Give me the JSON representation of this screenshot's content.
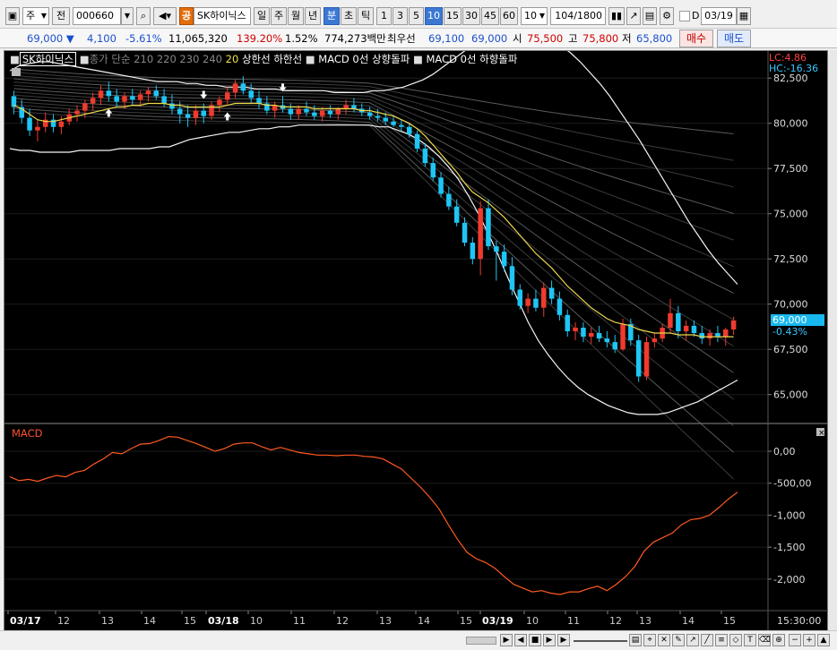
{
  "toolbar": {
    "market": "주",
    "prev": "전",
    "code": "000660",
    "logo": "공",
    "name": "SK하이닉스",
    "periods": [
      "일",
      "주",
      "월",
      "년"
    ],
    "intraday": [
      "분",
      "초",
      "틱"
    ],
    "minutes": [
      "1",
      "3",
      "5",
      "10",
      "15",
      "30",
      "45",
      "60"
    ],
    "active_minute": "10",
    "count": "10",
    "range": "104/1800",
    "d_label": "D",
    "date": "03/19"
  },
  "quote": {
    "price": "69,000",
    "arrow": "▼",
    "change": "4,100",
    "change_pct": "-5.61%",
    "volume": "11,065,320",
    "vol_ratio": "139.20%",
    "turnover": "1.52%",
    "amount": "774,273백만",
    "bid_label": "최우선",
    "bid": "69,100",
    "ask": "69,000",
    "open_label": "시",
    "open": "75,500",
    "high_label": "고",
    "high": "75,800",
    "low_label": "저",
    "low": "65,800",
    "buy": "매수",
    "sell": "매도"
  },
  "legend": {
    "name": "SK하이닉스",
    "ma": "종가 단순",
    "ma_periods": "210 220 230 240",
    "ma20": "20",
    "bands": "상한선  하한선",
    "macd_up": "MACD 0선 상향돌파",
    "macd_down": "MACD 0선 하향돌파",
    "lc": "LC:4.86",
    "hc": "HC:-16.36",
    "price_tag": "69,000",
    "pct_tag": "-0.43%"
  },
  "macd_label": "MACD",
  "chart_data": [
    {
      "type": "candlestick",
      "title": "SK하이닉스",
      "x": [
        "03/17",
        "12",
        "13",
        "14",
        "15",
        "03/18",
        "10",
        "11",
        "12",
        "13",
        "14",
        "15",
        "03/19",
        "10",
        "11",
        "12",
        "13",
        "14",
        "15"
      ],
      "ylim": [
        63500,
        83500
      ],
      "yticks": [
        65000,
        67500,
        70000,
        72500,
        75000,
        77500,
        80000,
        82500
      ],
      "ytick_labels": [
        "65,000",
        "67,500",
        "70,000",
        "72,500",
        "75,000",
        "77,500",
        "80,000",
        "82,500"
      ],
      "candles": [
        [
          81500,
          81800,
          80500,
          80900
        ],
        [
          80900,
          81300,
          80000,
          80300
        ],
        [
          80300,
          80800,
          79300,
          79600
        ],
        [
          79600,
          80200,
          79000,
          79800
        ],
        [
          79800,
          80600,
          79500,
          80200
        ],
        [
          80200,
          80500,
          79500,
          79800
        ],
        [
          79800,
          80400,
          79400,
          80100
        ],
        [
          80100,
          80800,
          79900,
          80500
        ],
        [
          80500,
          81000,
          80100,
          80700
        ],
        [
          80700,
          81300,
          80300,
          81100
        ],
        [
          81100,
          81700,
          80700,
          81400
        ],
        [
          81400,
          82100,
          81000,
          81800
        ],
        [
          81800,
          82300,
          81200,
          81500
        ],
        [
          81500,
          81900,
          80900,
          81200
        ],
        [
          81200,
          81700,
          80800,
          81500
        ],
        [
          81500,
          81900,
          81000,
          81300
        ],
        [
          81300,
          81800,
          80900,
          81600
        ],
        [
          81600,
          82000,
          81200,
          81800
        ],
        [
          81800,
          82100,
          81300,
          81500
        ],
        [
          81500,
          81900,
          80900,
          81100
        ],
        [
          81100,
          81600,
          80500,
          80800
        ],
        [
          80800,
          81200,
          80000,
          80500
        ],
        [
          80500,
          81000,
          79800,
          80300
        ],
        [
          80300,
          81000,
          79900,
          80700
        ],
        [
          80700,
          81100,
          80000,
          80400
        ],
        [
          80400,
          81200,
          80200,
          81000
        ],
        [
          81000,
          81500,
          80600,
          81300
        ],
        [
          81300,
          82000,
          81000,
          81700
        ],
        [
          81700,
          82400,
          81400,
          82200
        ],
        [
          82200,
          82600,
          81600,
          81800
        ],
        [
          81800,
          82200,
          81100,
          81400
        ],
        [
          81400,
          81800,
          80800,
          81100
        ],
        [
          81100,
          81500,
          80500,
          80700
        ],
        [
          80700,
          81200,
          80300,
          81000
        ],
        [
          81000,
          81500,
          80600,
          80800
        ],
        [
          80800,
          81100,
          80200,
          80500
        ],
        [
          80500,
          81000,
          80200,
          80800
        ],
        [
          80800,
          81200,
          80400,
          80600
        ],
        [
          80600,
          81000,
          80200,
          80400
        ],
        [
          80400,
          80900,
          80100,
          80700
        ],
        [
          80700,
          81000,
          80300,
          80500
        ],
        [
          80500,
          80900,
          80200,
          80800
        ],
        [
          80800,
          81300,
          80500,
          81000
        ],
        [
          81000,
          81400,
          80600,
          80800
        ],
        [
          80800,
          81100,
          80400,
          80600
        ],
        [
          80600,
          80900,
          80200,
          80400
        ],
        [
          80400,
          80800,
          80100,
          80300
        ],
        [
          80300,
          80600,
          79900,
          80100
        ],
        [
          80100,
          80400,
          79800,
          79900
        ],
        [
          79900,
          80200,
          79600,
          79800
        ],
        [
          79800,
          80000,
          79200,
          79400
        ],
        [
          79400,
          79600,
          78400,
          78600
        ],
        [
          78600,
          78900,
          77600,
          77800
        ],
        [
          77800,
          78100,
          76800,
          77000
        ],
        [
          77000,
          77300,
          75900,
          76100
        ],
        [
          76100,
          76500,
          75200,
          75400
        ],
        [
          75400,
          75800,
          74300,
          74500
        ],
        [
          74500,
          74800,
          73200,
          73400
        ],
        [
          73400,
          73700,
          72200,
          72500
        ],
        [
          72500,
          75700,
          71600,
          75300
        ],
        [
          75300,
          75800,
          73000,
          73200
        ],
        [
          73200,
          73500,
          71300,
          72900
        ],
        [
          72900,
          73300,
          71800,
          72100
        ],
        [
          72100,
          72600,
          70500,
          70800
        ],
        [
          70800,
          71100,
          69700,
          69900
        ],
        [
          69900,
          70600,
          69500,
          70300
        ],
        [
          70300,
          70800,
          69600,
          69800
        ],
        [
          69800,
          71200,
          69300,
          70900
        ],
        [
          70900,
          71300,
          70000,
          70300
        ],
        [
          70300,
          70700,
          69100,
          69400
        ],
        [
          69400,
          69700,
          68200,
          68500
        ],
        [
          68500,
          69000,
          68000,
          68700
        ],
        [
          68700,
          69000,
          67900,
          68200
        ],
        [
          68200,
          68700,
          67800,
          68400
        ],
        [
          68400,
          68800,
          67900,
          68100
        ],
        [
          68100,
          68500,
          67600,
          67900
        ],
        [
          67900,
          68300,
          67300,
          67500
        ],
        [
          67500,
          69200,
          67400,
          68900
        ],
        [
          68900,
          69200,
          67700,
          68000
        ],
        [
          68000,
          68300,
          65700,
          66000
        ],
        [
          66000,
          68200,
          65800,
          67900
        ],
        [
          67900,
          68400,
          67600,
          68100
        ],
        [
          68100,
          68900,
          67900,
          68700
        ],
        [
          68700,
          70300,
          68400,
          69500
        ],
        [
          69500,
          69900,
          68100,
          68500
        ],
        [
          68500,
          69100,
          68000,
          68800
        ],
        [
          68800,
          69100,
          68200,
          68400
        ],
        [
          68400,
          68800,
          67800,
          68100
        ],
        [
          68100,
          68600,
          67700,
          68400
        ],
        [
          68400,
          68800,
          67900,
          68200
        ],
        [
          68200,
          68700,
          67700,
          68600
        ],
        [
          68600,
          69300,
          68300,
          69100
        ]
      ],
      "series": [
        {
          "name": "20",
          "values": [
            81000,
            80800,
            80500,
            80200,
            80100,
            80100,
            80200,
            80300,
            80400,
            80500,
            80600,
            80700,
            80800,
            80900,
            80900,
            81000,
            81000,
            81100,
            81100,
            81100,
            81000,
            81000,
            80900,
            80900,
            80900,
            80900,
            80900,
            81000,
            81100,
            81100,
            81100,
            81100,
            81000,
            81000,
            80900,
            80900,
            80900,
            80900,
            80800,
            80800,
            80800,
            80800,
            80800,
            80800,
            80700,
            80700,
            80600,
            80500,
            80400,
            80200,
            80000,
            79700,
            79300,
            78800,
            78300,
            77800,
            77300,
            76700,
            76200,
            75900,
            75600,
            75200,
            74800,
            74300,
            73800,
            73300,
            72800,
            72400,
            72000,
            71500,
            71000,
            70600,
            70200,
            69800,
            69500,
            69200,
            69000,
            68900,
            68800,
            68600,
            68500,
            68400,
            68400,
            68400,
            68300,
            68300,
            68300,
            68200,
            68200,
            68200,
            68200,
            68200
          ]
        },
        {
          "name": "상한선",
          "values": [
            82900,
            83200,
            83300,
            83400,
            83400,
            83300,
            83200,
            83100,
            83000,
            82900,
            82800,
            82700,
            82600,
            82500,
            82400,
            82300,
            82300,
            82300,
            82200,
            82200,
            82100,
            82100,
            82000,
            82000,
            82000,
            81900,
            81900,
            81900,
            81800,
            81800,
            81800,
            81800,
            81800,
            81700,
            81700,
            81700,
            81700,
            81800,
            81800,
            81900,
            82000,
            82200,
            82400,
            82700,
            83100,
            83500,
            83900,
            84300,
            84700,
            84900,
            85100,
            85200,
            85200,
            85100,
            84900,
            84600,
            84300,
            83900,
            83400,
            82800,
            82200,
            81500,
            80700,
            79900,
            79100,
            78200,
            77300,
            76400,
            75500,
            74600,
            73800,
            73000,
            72300,
            71700,
            71100
          ]
        },
        {
          "name": "하한선",
          "values": [
            78600,
            78500,
            78500,
            78400,
            78400,
            78400,
            78400,
            78500,
            78500,
            78500,
            78500,
            78600,
            78600,
            78600,
            78600,
            78700,
            78700,
            78900,
            79100,
            79200,
            79300,
            79400,
            79500,
            79500,
            79600,
            79700,
            79700,
            79800,
            79800,
            79900,
            79900,
            79900,
            79900,
            79900,
            79900,
            79900,
            79900,
            79800,
            79800,
            79600,
            79400,
            79100,
            78700,
            78200,
            77600,
            76900,
            76000,
            75000,
            73900,
            72700,
            71400,
            70200,
            69000,
            68000,
            67200,
            66500,
            65900,
            65400,
            65000,
            64700,
            64400,
            64200,
            64000,
            63900,
            63900,
            63900,
            64000,
            64200,
            64400,
            64600,
            64900,
            65200,
            65500,
            65800
          ]
        }
      ]
    },
    {
      "type": "line",
      "title": "MACD",
      "ylim": [
        -2450,
        350
      ],
      "yticks": [
        0,
        -500,
        -1000,
        -1500,
        -2000
      ],
      "ytick_labels": [
        "0,00",
        "-500,00",
        "-1,000",
        "-1,500",
        "-2,000"
      ],
      "series": [
        {
          "name": "MACD",
          "values": [
            -400,
            -460,
            -440,
            -470,
            -420,
            -380,
            -400,
            -330,
            -300,
            -200,
            -120,
            -20,
            -40,
            40,
            110,
            120,
            170,
            230,
            220,
            170,
            120,
            60,
            0,
            40,
            110,
            130,
            130,
            70,
            20,
            60,
            20,
            -20,
            -40,
            -60,
            -60,
            -70,
            -60,
            -60,
            -80,
            -90,
            -120,
            -200,
            -280,
            -420,
            -560,
            -720,
            -900,
            -1150,
            -1380,
            -1580,
            -1680,
            -1740,
            -1830,
            -1960,
            -2080,
            -2140,
            -2200,
            -2180,
            -2220,
            -2240,
            -2200,
            -2200,
            -2150,
            -2110,
            -2180,
            -2080,
            -1960,
            -1800,
            -1560,
            -1420,
            -1350,
            -1280,
            -1150,
            -1070,
            -1050,
            -1000,
            -880,
            -750,
            -640
          ]
        }
      ]
    }
  ]
}
